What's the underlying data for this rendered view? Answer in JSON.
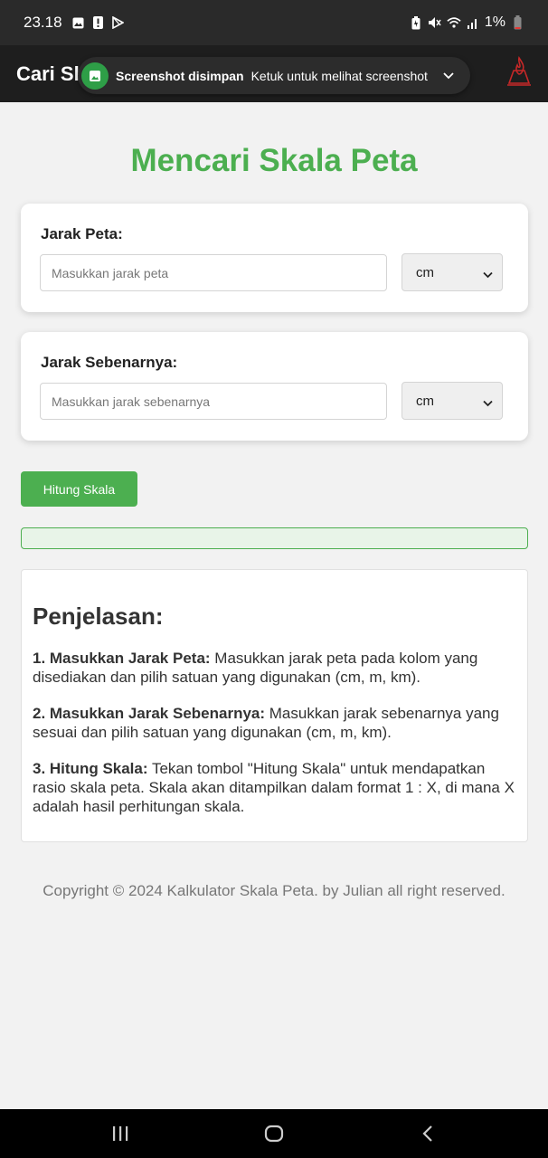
{
  "status_bar": {
    "time": "23.18",
    "battery": "1%"
  },
  "app_bar": {
    "title": "Cari Sk"
  },
  "toast": {
    "title": "Screenshot disimpan",
    "message": "Ketuk untuk melihat screenshot"
  },
  "page": {
    "title": "Mencari Skala Peta"
  },
  "map_distance": {
    "label": "Jarak Peta:",
    "placeholder": "Masukkan jarak peta",
    "unit": "cm"
  },
  "real_distance": {
    "label": "Jarak Sebenarnya:",
    "placeholder": "Masukkan jarak sebenarnya",
    "unit": "cm"
  },
  "calculate_button": {
    "label": "Hitung Skala"
  },
  "explanation": {
    "title": "Penjelasan:",
    "items": [
      {
        "heading": "1. Masukkan Jarak Peta:",
        "text": " Masukkan jarak peta pada kolom yang disediakan dan pilih satuan yang digunakan (cm, m, km)."
      },
      {
        "heading": "2. Masukkan Jarak Sebenarnya:",
        "text": " Masukkan jarak sebenarnya yang sesuai dan pilih satuan yang digunakan (cm, m, km)."
      },
      {
        "heading": "3. Hitung Skala:",
        "text": " Tekan tombol \"Hitung Skala\" untuk mendapatkan rasio skala peta. Skala akan ditampilkan dalam format 1 : X, di mana X adalah hasil perhitungan skala."
      }
    ]
  },
  "footer": {
    "text": "Copyright © 2024 Kalkulator Skala Peta. by Julian all right reserved."
  },
  "colors": {
    "accent": "#4caf50",
    "app_bar": "#1e1e1e",
    "background": "#f2f2f2"
  },
  "icons": {
    "status_left": [
      "gallery-icon",
      "alert-icon",
      "play-store-icon"
    ],
    "status_right": [
      "battery-saver-icon",
      "mute-icon",
      "wifi-icon",
      "signal-icon",
      "battery-icon"
    ],
    "app_logo": "flame-logo-icon",
    "nav": [
      "recents-icon",
      "home-icon",
      "back-icon"
    ]
  }
}
